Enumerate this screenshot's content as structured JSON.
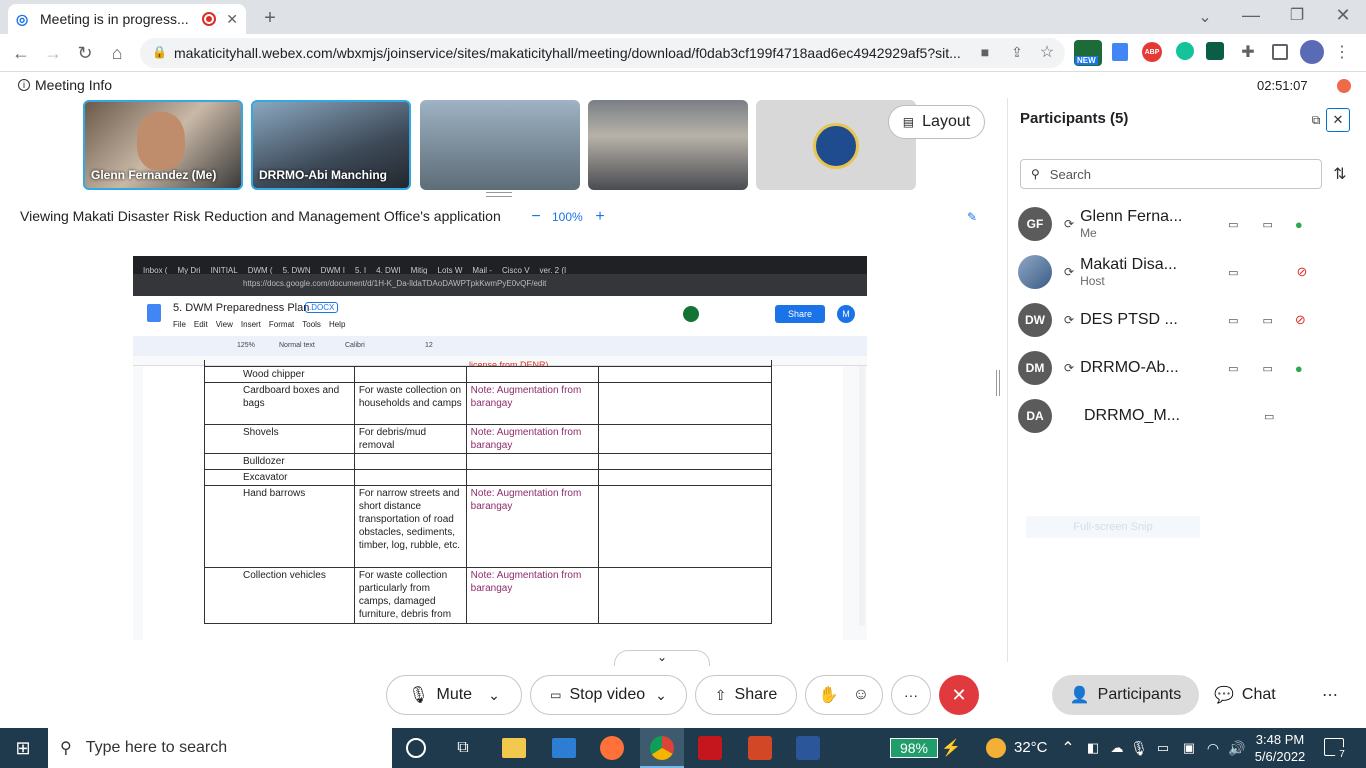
{
  "browser": {
    "tab_title": "Meeting is in progress...",
    "new_tab_icon": "+",
    "url": "makaticityhall.webex.com/wbxmjs/joinservice/sites/makaticityhall/meeting/download/f0dab3cf199f4718aad6ec4942929af5?sit...",
    "new_badge": "NEW",
    "abp_label": "ABP"
  },
  "meeting": {
    "info_label": "Meeting Info",
    "timer": "02:51:07",
    "layout_label": "Layout",
    "viewing_text": "Viewing Makati Disaster Risk Reduction and Management Office's application",
    "zoom": "100%",
    "zoom_out": "−",
    "zoom_in": "+",
    "videos": [
      {
        "name": "Glenn Fernandez (Me)"
      },
      {
        "name": "DRRMO-Abi Manching"
      },
      {
        "name": ""
      },
      {
        "name": ""
      },
      {
        "name": ""
      }
    ]
  },
  "controls": {
    "mute": "Mute",
    "stop_video": "Stop video",
    "share": "Share",
    "more": "···",
    "participants": "Participants",
    "chat": "Chat"
  },
  "participants_panel": {
    "title": "Participants (5)",
    "search_placeholder": "Search",
    "faded_text": "Full-screen Snip",
    "list": [
      {
        "initials": "GF",
        "name": "Glenn Ferna...",
        "role": "Me",
        "mic": "on"
      },
      {
        "initials": "",
        "name": "Makati Disa...",
        "role": "Host",
        "mic": "muted"
      },
      {
        "initials": "DW",
        "name": "DES PTSD ...",
        "role": "",
        "mic": "muted"
      },
      {
        "initials": "DM",
        "name": "DRRMO-Ab...",
        "role": "",
        "mic": "on"
      },
      {
        "initials": "DA",
        "name": "DRRMO_M...",
        "role": "",
        "mic": ""
      }
    ]
  },
  "shared_doc": {
    "tabs": [
      "Inbox (",
      "My Dri",
      "INITIAL",
      "DWM (",
      "5. DWN",
      "DWM I",
      "5. I",
      "4. DWI",
      "Mitig",
      "Lots W",
      "Mail -",
      "Cisco V",
      "ver. 2 (I"
    ],
    "url": "https://docs.google.com/document/d/1H-K_Da-lldaTDAoDAWPTpkKwmPyE0vQF/edit",
    "title": "5. DWM Preparedness Plan",
    "badge": ".DOCX",
    "menus": [
      "File",
      "Edit",
      "View",
      "Insert",
      "Format",
      "Tools",
      "Help"
    ],
    "share": "Share",
    "avatar": "M",
    "zoom": "125%",
    "style": "Normal text",
    "font": "Calibri",
    "font_size": "12",
    "top_fragment": "license from DENR)",
    "rows": [
      {
        "item": "Wood chipper",
        "use": "",
        "note": ""
      },
      {
        "item": "Cardboard boxes and bags",
        "use": "For waste collection on households and camps",
        "note": "Note: Augmentation from barangay"
      },
      {
        "item": "Shovels",
        "use": "For debris/mud removal",
        "note": "Note: Augmentation from barangay"
      },
      {
        "item": "Bulldozer",
        "use": "",
        "note": ""
      },
      {
        "item": "Excavator",
        "use": "",
        "note": ""
      },
      {
        "item": "Hand barrows",
        "use": "For narrow streets and short distance transportation of road obstacles, sediments, timber, log, rubble, etc.",
        "note": "Note: Augmentation from barangay"
      },
      {
        "item": "Collection vehicles",
        "use": "For waste collection particularly from camps, damaged furniture, debris from",
        "note": "Note: Augmentation from barangay"
      }
    ]
  },
  "taskbar": {
    "search_placeholder": "Type here to search",
    "battery": "98%",
    "temperature": "32°C",
    "time": "3:48 PM",
    "date": "5/6/2022",
    "notifications": "7"
  },
  "colors": {
    "end_call": "#e0393e",
    "accent": "#1a73e8",
    "taskbar": "#1f3a4d"
  }
}
